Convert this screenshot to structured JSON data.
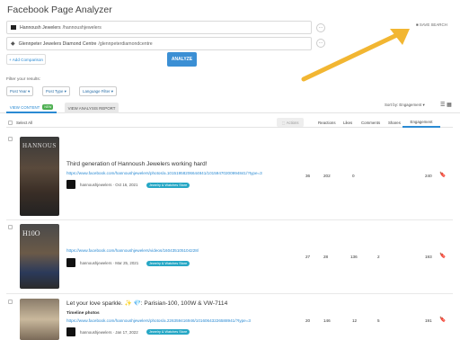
{
  "app": {
    "title": "Facebook Page Analyzer"
  },
  "inputs": [
    {
      "name": "Hannoush Jewelers",
      "slug": "/hannoushjewelers"
    },
    {
      "name": "Glennpeter Jewelers Diamond Centre",
      "slug": "/glennpeterdiamondcentre"
    }
  ],
  "more_label": "⋯",
  "add_comparison": "+ Add Comparison",
  "analyze_label": "ANALYZE",
  "save_search": "SAVE SEARCH",
  "filter_label": "Filter your results:",
  "filters": [
    "Post Year",
    "Post Type",
    "Language Filter"
  ],
  "tabs": {
    "view_content": "VIEW CONTENT",
    "new_badge": "NEW",
    "analysis": "VIEW ANALYSIS REPORT"
  },
  "sort_label": "Sort by: Engagement",
  "select_all": "Select All",
  "actions_label": "Actions",
  "columns": [
    "Reactions",
    "Likes",
    "Comments",
    "Shares",
    "Engagement"
  ],
  "posts": [
    {
      "text": "Third generation of Hannoush Jewelers working hard!",
      "sub": "",
      "link": "https://www.facebook.com/hannoushjewelers/photos/a.10151958206644841/10159470200994841/?type=3",
      "author": "hannoushjewelers · Oct 16, 2021",
      "tag": "Jewelry & Watches Store",
      "metrics": [
        "36",
        "202",
        "0",
        "",
        "240"
      ]
    },
    {
      "text": "",
      "sub": "",
      "link": "https://www.facebook.com/hannoushjewelers/videos/160435105104228/",
      "author": "hannoushjewelers · Mar 25, 2021",
      "tag": "Jewelry & Watches Store",
      "metrics": [
        "27",
        "28",
        "136",
        "2",
        "193"
      ]
    },
    {
      "text": "Let your love sparkle. ✨ 💎: Parisian-100, 100W & VW-7114",
      "sub": "Timeline photos",
      "link": "https://www.facebook.com/hannoushjewelers/photos/a.226359416946/10160643226588941/?type=3",
      "author": "hannoushjewelers · Jan 17, 2022",
      "tag": "Jewelry & Watches Store",
      "metrics": [
        "20",
        "146",
        "12",
        "5",
        "191"
      ]
    }
  ],
  "icons": {
    "bookmark": "bookmark-icon",
    "list-view": "list-view-icon",
    "grid-view": "grid-view-icon",
    "save": "save-icon"
  },
  "colors": {
    "accent": "#2a8ad3",
    "tag": "#26a7c5",
    "arrow": "#f2b632"
  }
}
